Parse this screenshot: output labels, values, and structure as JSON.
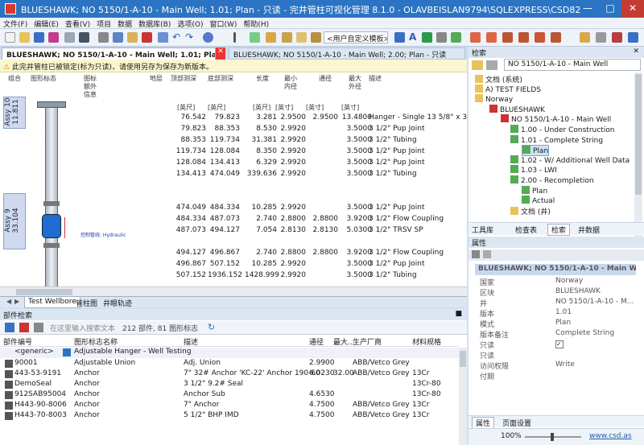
{
  "window": {
    "title": "BLUESHAWK; NO 5150/1-A-10 - Main Well; 1.01; Plan - 只读 - 完井管柱可视化管理 8.1.0 - OLAVBEISLAN9794\\SQLEXPRESS\\CSD82"
  },
  "menu": [
    "文件(F)",
    "编辑(E)",
    "查看(V)",
    "项目",
    "数据",
    "数据库(B)",
    "选项(O)",
    "窗口(W)",
    "帮助(H)"
  ],
  "toolbar": {
    "combo_value": "<用户自定义模板>"
  },
  "doc_tabs": [
    {
      "label": "BLUESHAWK; NO 5150/1-A-10 - Main Well; 1.01; Plan - 只读"
    },
    {
      "label": "BLUESHAWK; NO 5150/1-A-10 - Main Well; 2.00; Plan - 只读"
    }
  ],
  "warning": "此完井管柱已被锁定(标为只读)，请使用另存为保存为新版本。",
  "grid": {
    "headers": [
      "组合",
      "图形标态",
      "图标 额外 信息",
      "地层",
      "顶部测深",
      "底部测深",
      "长度",
      "最小 内径",
      "通径",
      "最大 外径",
      "描述"
    ],
    "units": [
      "[英尺]",
      "[英尺]",
      "[英尺]",
      "[英寸]",
      "[英寸]",
      "[英寸]"
    ],
    "rows": [
      {
        "top": "76.542",
        "bottom": "79.823",
        "length": "3.281",
        "min_id": "2.9500",
        "drift": "2.9500",
        "max_od": "13.4800",
        "desc": "Hanger - Single 13 5/8\" x 3"
      },
      {
        "top": "79.823",
        "bottom": "88.353",
        "length": "8.530",
        "min_id": "2.9920",
        "drift": "",
        "max_od": "3.5000",
        "desc": "3 1/2\" Pup Joint"
      },
      {
        "top": "88.353",
        "bottom": "119.734",
        "length": "31.381",
        "min_id": "2.9920",
        "drift": "",
        "max_od": "3.5000",
        "desc": "3 1/2\" Tubing"
      },
      {
        "top": "119.734",
        "bottom": "128.084",
        "length": "8.350",
        "min_id": "2.9920",
        "drift": "",
        "max_od": "3.5000",
        "desc": "3 1/2\" Pup Joint"
      },
      {
        "top": "128.084",
        "bottom": "134.413",
        "length": "6.329",
        "min_id": "2.9920",
        "drift": "",
        "max_od": "3.5000",
        "desc": "3 1/2\" Pup Joint"
      },
      {
        "top": "134.413",
        "bottom": "474.049",
        "length": "339.636",
        "min_id": "2.9920",
        "drift": "",
        "max_od": "3.5000",
        "desc": "3 1/2\" Tubing"
      },
      {
        "top": "474.049",
        "bottom": "484.334",
        "length": "10.285",
        "min_id": "2.9920",
        "drift": "",
        "max_od": "3.5000",
        "desc": "3 1/2\" Pup Joint"
      },
      {
        "top": "484.334",
        "bottom": "487.073",
        "length": "2.740",
        "min_id": "2.8800",
        "drift": "2.8800",
        "max_od": "3.9200",
        "desc": "3 1/2\" Flow Coupling"
      },
      {
        "top": "487.073",
        "bottom": "494.127",
        "length": "7.054",
        "min_id": "2.8130",
        "drift": "2.8130",
        "max_od": "5.0300",
        "desc": "3 1/2\" TRSV SP"
      },
      {
        "top": "494.127",
        "bottom": "496.867",
        "length": "2.740",
        "min_id": "2.8800",
        "drift": "2.8800",
        "max_od": "3.9200",
        "desc": "3 1/2\" Flow Coupling"
      },
      {
        "top": "496.867",
        "bottom": "507.152",
        "length": "10.285",
        "min_id": "2.9920",
        "drift": "",
        "max_od": "3.5000",
        "desc": "3 1/2\" Pup Joint"
      },
      {
        "top": "507.152",
        "bottom": "1936.152",
        "length": "1428.999",
        "min_id": "2.9920",
        "drift": "",
        "max_od": "3.5000",
        "desc": "3 1/2\" Tubing"
      }
    ],
    "assy1": "Assy 10\n11.811",
    "assy2": "Assy 9\n33.104",
    "control_line": "控制管线: Hydraulic"
  },
  "bottom_tabs": [
    "Test Wellbore",
    "管柱图",
    "井眼轨迹"
  ],
  "parts": {
    "title": "部件检索",
    "search_placeholder": "在这里输入搜索文本",
    "count": "212 部件, 81 图形标志",
    "columns": [
      "部件编号",
      "图形标志名称",
      "描述",
      "通径",
      "最大...",
      "生产厂商",
      "材料规格"
    ],
    "generic_row": {
      "id": "<generic>",
      "name": "Adjustable Hanger - Well Testing"
    },
    "rows": [
      {
        "id": "90001",
        "name": "Adjustable Union",
        "desc": "Adj. Union",
        "drift": "2.9900",
        "max": "",
        "maker": "ABB/Vetco Grey",
        "mat": ""
      },
      {
        "id": "443-53-9191",
        "name": "Anchor",
        "desc": "7\" 32# Anchor 'KC-22' Anchor 190-60",
        "drift": "6.0230",
        "max": "32.00",
        "maker": "ABB/Vetco Grey",
        "mat": "13Cr"
      },
      {
        "id": "DemoSeal",
        "name": "Anchor",
        "desc": "3 1/2\" 9.2# Seal",
        "drift": "",
        "max": "",
        "maker": "",
        "mat": "13Cr-80"
      },
      {
        "id": "912SAB95004",
        "name": "Anchor",
        "desc": "Anchor Sub",
        "drift": "4.6530",
        "max": "",
        "maker": "",
        "mat": "13Cr-80"
      },
      {
        "id": "H443-90-8006",
        "name": "Anchor",
        "desc": "7\" Anchor",
        "drift": "4.7500",
        "max": "",
        "maker": "ABB/Vetco Grey",
        "mat": "13Cr"
      },
      {
        "id": "H443-70-8003",
        "name": "Anchor",
        "desc": "5 1/2\" BHP IMD",
        "drift": "4.7500",
        "max": "",
        "maker": "ABB/Vetco Grey",
        "mat": "13Cr"
      }
    ]
  },
  "explorer": {
    "title": "检索",
    "combo": "NO 5150/1-A-10 - Main Well",
    "tree": [
      "文档 (系统)",
      "A) TEST FIELDS",
      "Norway",
      "BLUESHAWK",
      "NO 5150/1-A-10 - Main Well",
      "1.00 - Under Construction",
      "1.01 - Complete String",
      "Plan",
      "1.02 - W/ Additional Well Data",
      "1.03 - LWI",
      "2.00 - Recompletion",
      "Plan",
      "Actual",
      "文档 (井)"
    ],
    "tabs": [
      "工具库",
      "检查表",
      "检索",
      "井数据"
    ]
  },
  "properties": {
    "title": "属性",
    "header": "BLUESHAWK; NO 5150/1-A-10 - Main Well",
    "items": [
      {
        "k": "国家",
        "v": "Norway"
      },
      {
        "k": "区块",
        "v": "BLUESHAWK"
      },
      {
        "k": "井",
        "v": "NO 5150/1-A-10 - M..."
      },
      {
        "k": "版本",
        "v": "1.01"
      },
      {
        "k": "模式",
        "v": "Plan"
      },
      {
        "k": "版本备注",
        "v": "Complete String"
      },
      {
        "k": "只读",
        "v": ""
      },
      {
        "k": "只读",
        "v": ""
      },
      {
        "k": "访问权限",
        "v": "Write"
      },
      {
        "k": "付期",
        "v": ""
      }
    ],
    "tabs": [
      "属性",
      "页面设置"
    ]
  },
  "status": {
    "zoom": "100%",
    "link": "www.csd.as"
  },
  "colors": {
    "titlebar": "#2b74c3",
    "accent": "#1f5fa8"
  }
}
